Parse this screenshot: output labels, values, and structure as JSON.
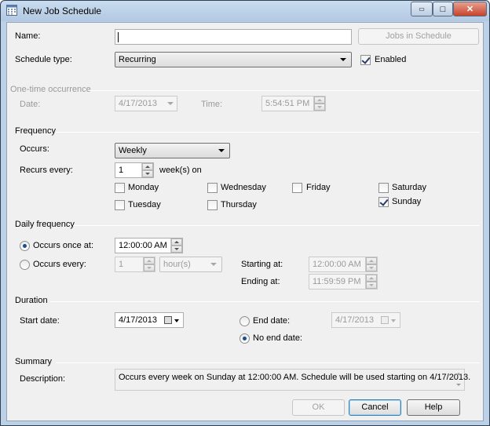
{
  "window": {
    "title": "New Job Schedule",
    "minimize": "▭",
    "maximize": "□",
    "close": "✕"
  },
  "general": {
    "name_label": "Name:",
    "name_value": "",
    "jobs_button": "Jobs in Schedule",
    "schedule_type_label": "Schedule type:",
    "schedule_type_value": "Recurring",
    "enabled_label": "Enabled",
    "enabled_checked": true
  },
  "one_time": {
    "section": "One-time occurrence",
    "date_label": "Date:",
    "date_value": "4/17/2013",
    "time_label": "Time:",
    "time_value": "5:54:51 PM"
  },
  "frequency": {
    "section": "Frequency",
    "occurs_label": "Occurs:",
    "occurs_value": "Weekly",
    "recurs_label": "Recurs every:",
    "recurs_value": "1",
    "recurs_unit": "week(s) on",
    "days": [
      {
        "label": "Monday",
        "checked": false
      },
      {
        "label": "Wednesday",
        "checked": false
      },
      {
        "label": "Friday",
        "checked": false
      },
      {
        "label": "Saturday",
        "checked": false
      },
      {
        "label": "Tuesday",
        "checked": false
      },
      {
        "label": "Thursday",
        "checked": false
      },
      {
        "label": "Sunday",
        "checked": true
      }
    ]
  },
  "daily": {
    "section": "Daily frequency",
    "once_label": "Occurs once at:",
    "once_value": "12:00:00 AM",
    "every_label": "Occurs every:",
    "every_value": "1",
    "every_unit": "hour(s)",
    "starting_label": "Starting at:",
    "starting_value": "12:00:00 AM",
    "ending_label": "Ending at:",
    "ending_value": "11:59:59 PM"
  },
  "duration": {
    "section": "Duration",
    "start_label": "Start date:",
    "start_value": "4/17/2013",
    "end_label": "End date:",
    "end_value": "4/17/2013",
    "no_end_label": "No end date:"
  },
  "summary": {
    "section": "Summary",
    "description_label": "Description:",
    "description_value": "Occurs every week on Sunday at 12:00:00 AM. Schedule will be used starting on 4/17/2013."
  },
  "buttons": {
    "ok": "OK",
    "cancel": "Cancel",
    "help": "Help"
  },
  "colors": {
    "title_bar": "#b9cde5",
    "dialog_bg": "#f0f0f0",
    "radio_dot": "#1c4d8f"
  }
}
